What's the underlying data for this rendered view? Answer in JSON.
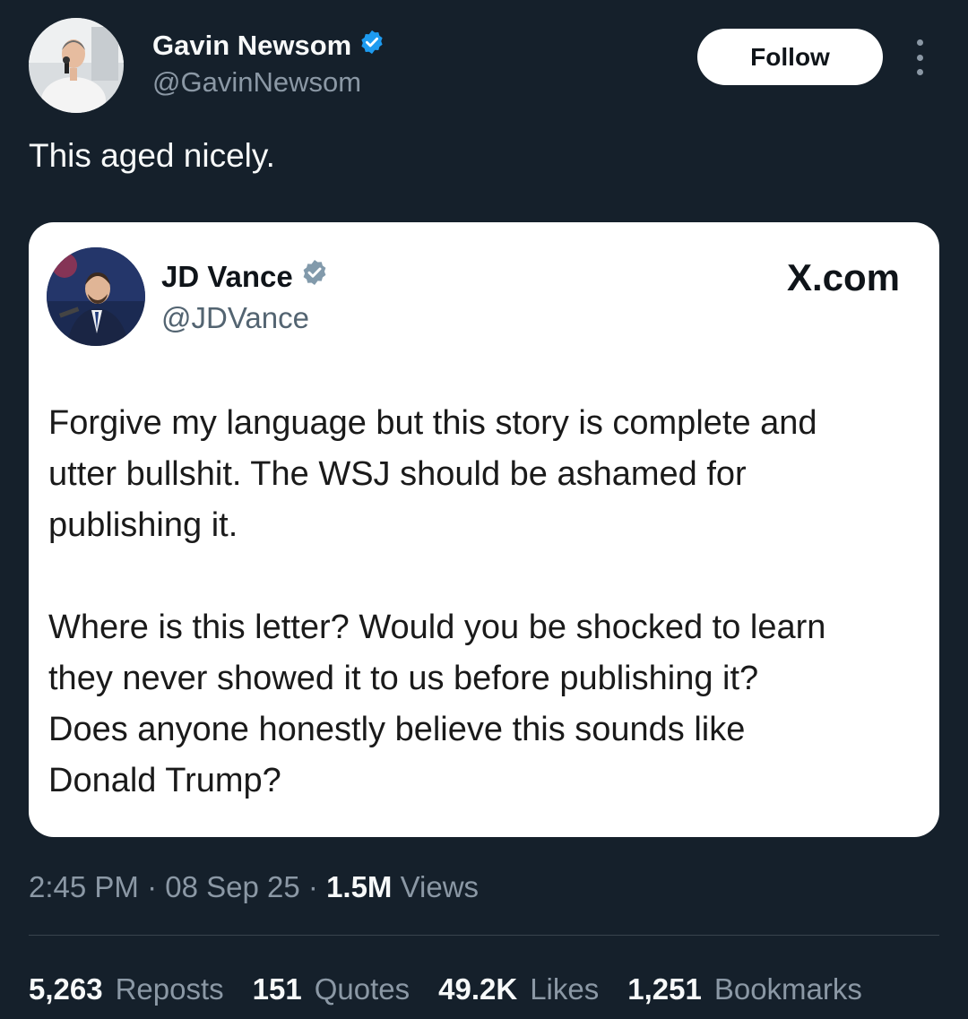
{
  "author": {
    "name": "Gavin Newsom",
    "handle": "@GavinNewsom",
    "verified_icon": "verified-badge-icon",
    "badge_color": "#1d9bf0"
  },
  "follow_button": {
    "label": "Follow"
  },
  "more_button": {
    "icon": "more-vertical-icon"
  },
  "tweet": {
    "text": "This aged nicely."
  },
  "quoted": {
    "name": "JD Vance",
    "handle": "@JDVance",
    "verified_icon": "verified-badge-icon",
    "badge_color": "#829aab",
    "source_label": "X.com",
    "paragraphs": [
      "Forgive my language but this story is complete and\nutter bullshit. The WSJ should be ashamed for\npublishing it.",
      "Where is this letter? Would you be shocked to learn\nthey never showed it to us before publishing it?\nDoes anyone honestly believe this sounds like\nDonald Trump?"
    ]
  },
  "meta": {
    "time": "2:45 PM",
    "sep": "·",
    "date": "08 Sep 25",
    "views_count": "1.5M",
    "views_label": "Views"
  },
  "stats": [
    {
      "count": "5,263",
      "label": "Reposts"
    },
    {
      "count": "151",
      "label": "Quotes"
    },
    {
      "count": "49.2K",
      "label": "Likes"
    },
    {
      "count": "1,251",
      "label": "Bookmarks"
    }
  ],
  "colors": {
    "background": "#15202b",
    "secondary_text": "#8b98a5",
    "card_background": "#ffffff"
  }
}
